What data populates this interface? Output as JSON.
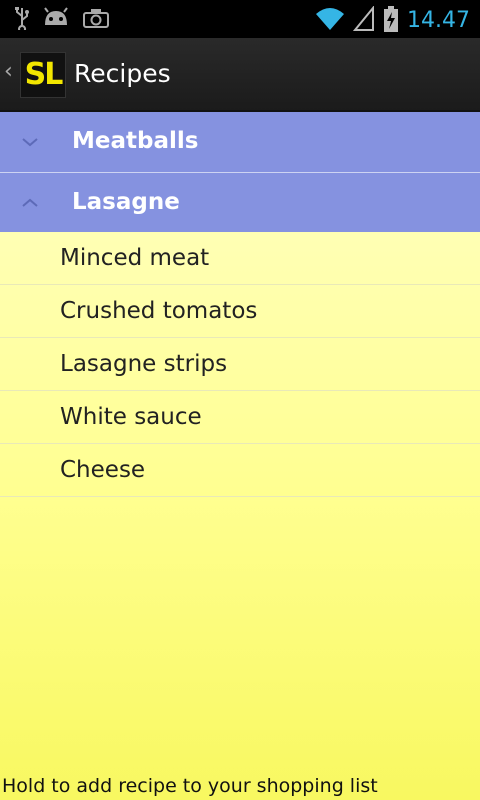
{
  "status": {
    "time": "14.47",
    "left_icons": [
      "usb-icon",
      "android-icon",
      "camera-icon"
    ],
    "right_icons": [
      "wifi-icon",
      "signal-icon",
      "battery-charging-icon"
    ]
  },
  "actionbar": {
    "logo_text": "SL",
    "title": "Recipes"
  },
  "groups": [
    {
      "label": "Meatballs",
      "expanded": false
    },
    {
      "label": "Lasagne",
      "expanded": true
    }
  ],
  "items": [
    {
      "label": "Minced meat"
    },
    {
      "label": "Crushed tomatos"
    },
    {
      "label": "Lasagne strips"
    },
    {
      "label": "White sauce"
    },
    {
      "label": "Cheese"
    }
  ],
  "footer": {
    "hint": "Hold to add recipe to your shopping list"
  },
  "colors": {
    "group_bg": "#8592e0",
    "list_bg": "#ffff90",
    "clock": "#35b5e5",
    "logo": "#f2e600"
  }
}
